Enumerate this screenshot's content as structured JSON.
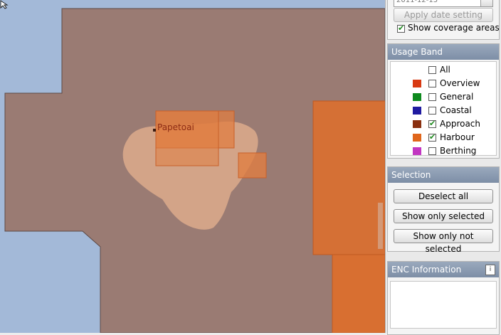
{
  "map": {
    "place_name": "Papetoai",
    "colors": {
      "sea": "#a3b9d8",
      "coverage": "#9a7b73",
      "island": "#d3a488",
      "harbour": "#e07e42"
    }
  },
  "date_panel": {
    "date_value": "2011-12-15",
    "apply_label": "Apply date setting",
    "show_coverage_label": "Show coverage areas",
    "show_coverage_checked": true
  },
  "usage_band": {
    "title": "Usage Band",
    "items": [
      {
        "label": "All",
        "color": "",
        "checked": false
      },
      {
        "label": "Overview",
        "color": "#d83a12",
        "checked": false
      },
      {
        "label": "General",
        "color": "#0e8a1e",
        "checked": false
      },
      {
        "label": "Coastal",
        "color": "#1f1aa0",
        "checked": false
      },
      {
        "label": "Approach",
        "color": "#8a3010",
        "checked": true
      },
      {
        "label": "Harbour",
        "color": "#e0661c",
        "checked": true
      },
      {
        "label": "Berthing",
        "color": "#c236c2",
        "checked": false
      }
    ]
  },
  "selection": {
    "title": "Selection",
    "deselect_all": "Deselect all",
    "show_only_selected": "Show only selected",
    "show_only_not_selected": "Show only not selected"
  },
  "enc_info": {
    "title": "ENC Information",
    "icon": "info-icon"
  }
}
